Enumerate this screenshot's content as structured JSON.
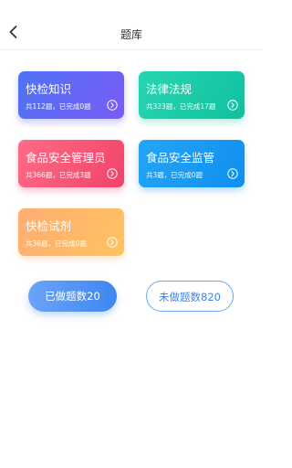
{
  "header": {
    "title": "题库",
    "back_icon": "chevron-left-icon"
  },
  "cards": [
    {
      "title": "快检知识",
      "meta": "共112题，已完成0题",
      "accent": "#4e73f5"
    },
    {
      "title": "法律法规",
      "meta": "共323题，已完成17题",
      "accent": "#10c1a0"
    },
    {
      "title": "食品安全管理员",
      "meta": "共366题，已完成3题",
      "accent": "#f1436a"
    },
    {
      "title": "食品安全监管",
      "meta": "共3题，已完成0题",
      "accent": "#0f8fef"
    },
    {
      "title": "快检试剂",
      "meta": "共36题，已完成0题",
      "accent": "#ffad73"
    }
  ],
  "buttons": {
    "done_label": "已做题数20",
    "undone_label": "未做题数820"
  },
  "icons": {
    "card_arrow": "chevron-right-circle-icon"
  }
}
